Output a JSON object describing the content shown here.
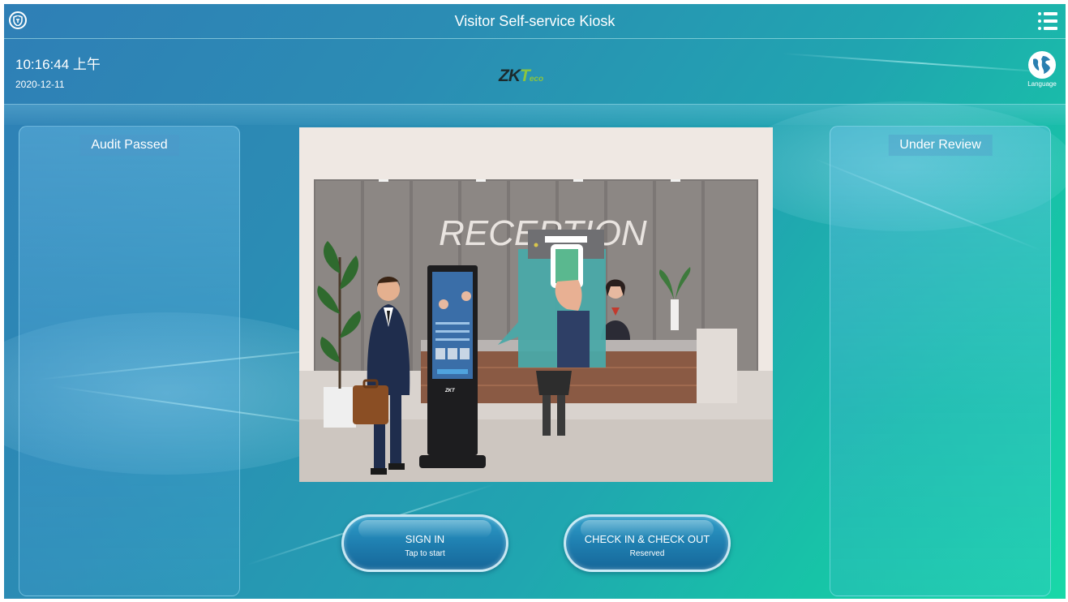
{
  "header": {
    "title": "Visitor Self-service Kiosk",
    "time": "10:16:44 上午",
    "date": "2020-12-11",
    "logo": {
      "zk": "ZK",
      "t": "T",
      "eco": "eco"
    },
    "language_label": "Language"
  },
  "panels": {
    "left_title": "Audit Passed",
    "right_title": "Under Review"
  },
  "illustration": {
    "sign_text": "RECEPTION"
  },
  "buttons": {
    "sign_in": {
      "label": "SIGN IN",
      "sub": "Tap to start"
    },
    "check": {
      "label": "CHECK IN & CHECK OUT",
      "sub": "Reserved"
    }
  },
  "colors": {
    "background_start": "#2f7fb6",
    "background_end": "#19d8a8",
    "logo_green": "#8bc43f",
    "button_blue": "#1f7fb0"
  },
  "icons": [
    "shield-icon",
    "menu-icon",
    "globe-icon"
  ]
}
